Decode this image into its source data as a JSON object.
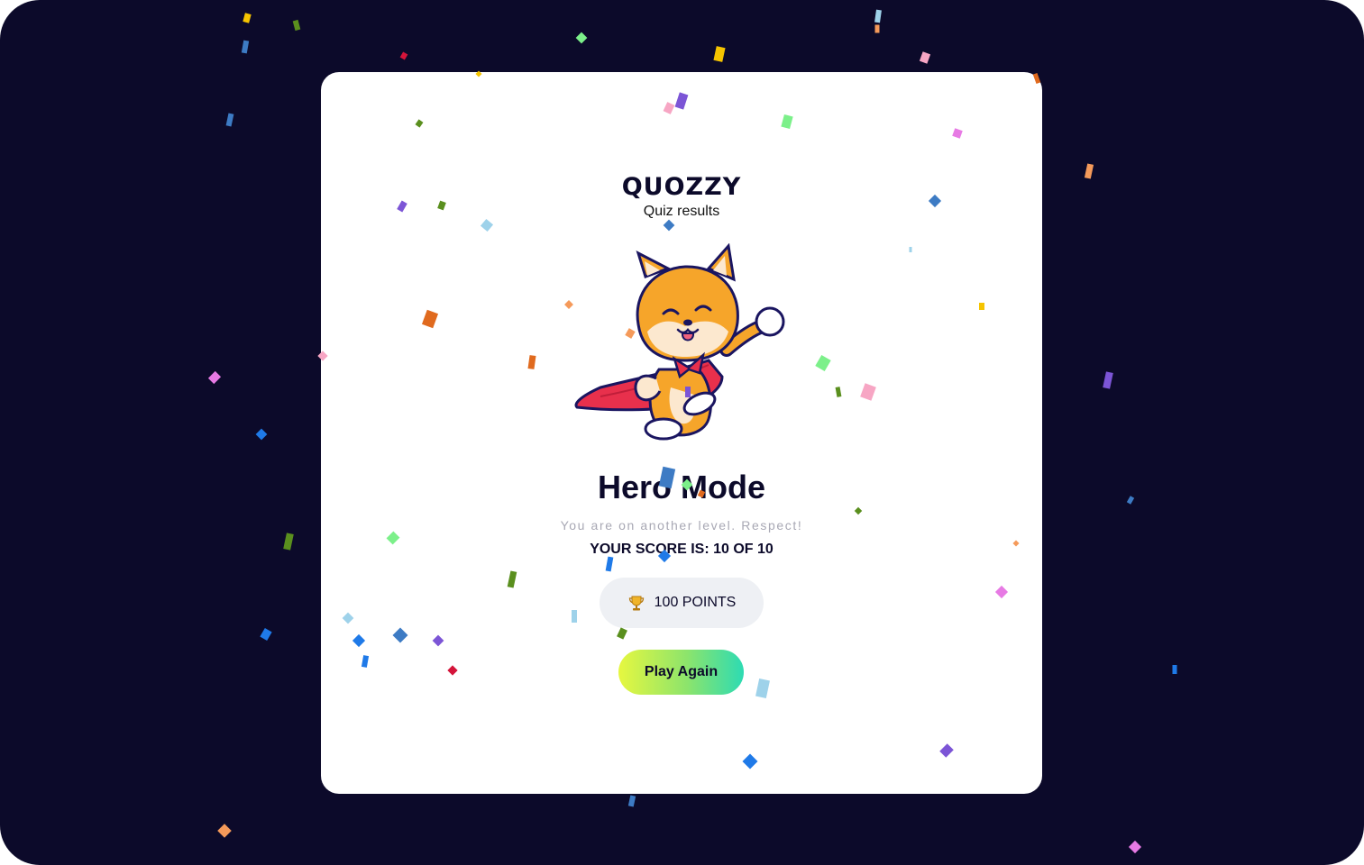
{
  "app": {
    "brand": "QUOZZY",
    "subtitle": "Quiz results"
  },
  "result": {
    "title": "Hero Mode",
    "description": "You are on another level. Respect!",
    "score_text": "YOUR SCORE IS: 10 OF 10",
    "score": 10,
    "total": 10
  },
  "points": {
    "icon": "trophy-icon",
    "label": "100 POINTS"
  },
  "actions": {
    "play_again_label": "Play Again"
  },
  "mascot": {
    "icon": "shiba-superhero-icon"
  },
  "colors": {
    "background": "#0c0a2a",
    "card": "#ffffff",
    "pill": "#eef0f4",
    "button_gradient": [
      "#e6f740",
      "#8ce46c",
      "#2ddbb3"
    ],
    "cape": "#e8304c",
    "fur": "#f6a52a"
  }
}
